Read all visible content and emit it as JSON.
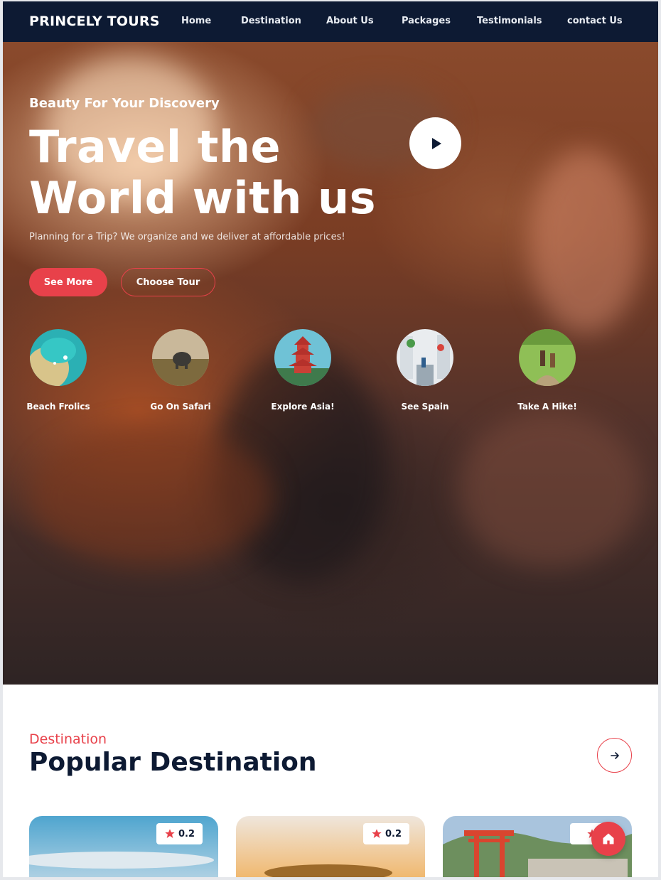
{
  "brand": "PRINCELY TOURS",
  "nav": {
    "items": [
      "Home",
      "Destination",
      "About Us",
      "Packages",
      "Testimonials",
      "contact Us"
    ]
  },
  "hero": {
    "subtitle": "Beauty For Your Discovery",
    "title_line1": "Travel the",
    "title_line2": "World with us",
    "description": "Planning for a Trip? We organize and we deliver at affordable prices!",
    "primary_button": "See More",
    "secondary_button": "Choose Tour",
    "categories": [
      {
        "label": "Beach Frolics"
      },
      {
        "label": "Go On Safari"
      },
      {
        "label": "Explore Asia!"
      },
      {
        "label": "See Spain"
      },
      {
        "label": "Take A Hike!"
      }
    ]
  },
  "destination": {
    "tag": "Destination",
    "title": "Popular Destination",
    "cards": [
      {
        "rating": "0.2"
      },
      {
        "rating": "0.2"
      },
      {
        "rating": ""
      }
    ]
  },
  "colors": {
    "accent": "#e8414a",
    "navy": "#0d1a33"
  },
  "icons": {
    "play": "play-icon",
    "arrow": "arrow-right-icon",
    "star": "star-icon",
    "home": "home-icon"
  }
}
